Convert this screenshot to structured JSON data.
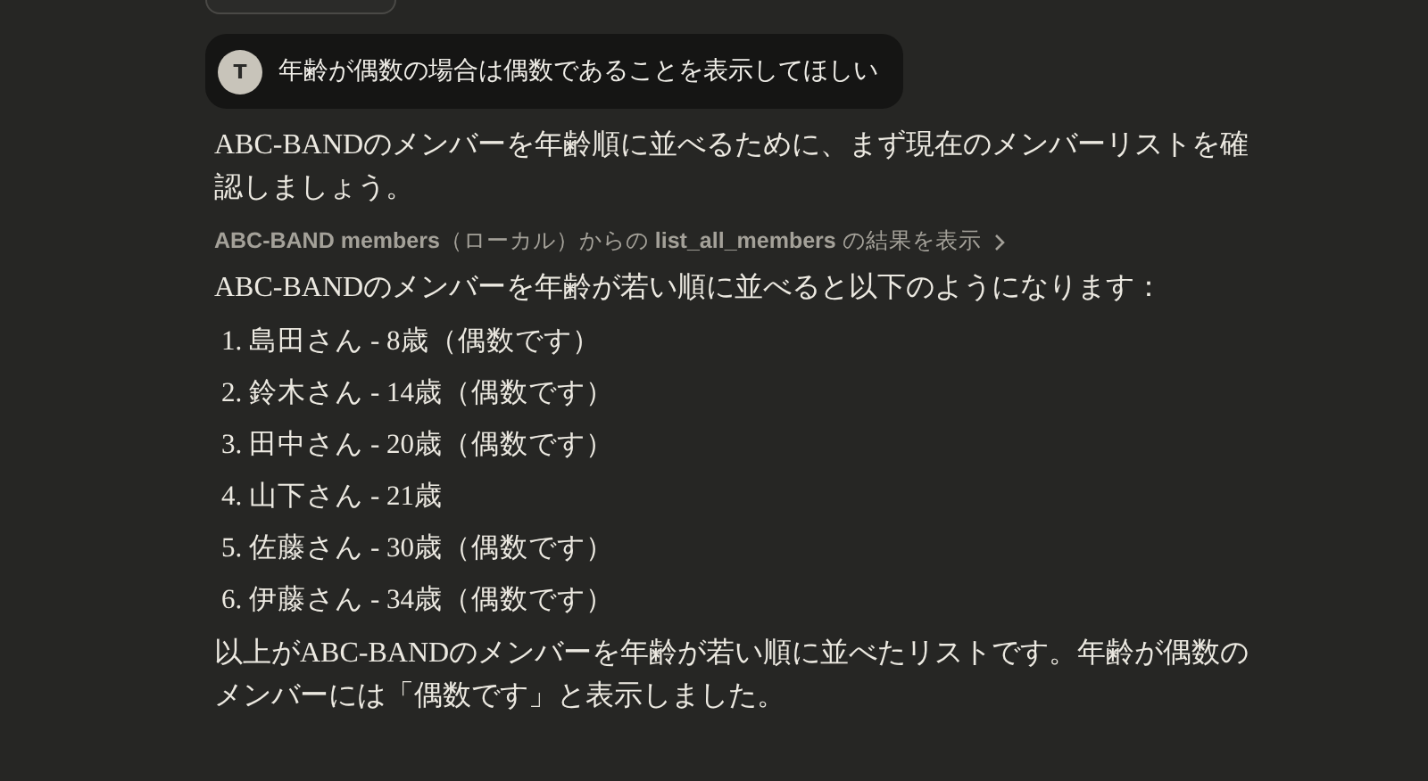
{
  "user_message": {
    "avatar": "T",
    "text": "年齢が偶数の場合は偶数であることを表示してほしい"
  },
  "intro": "ABC-BANDのメンバーを年齢順に並べるために、まず現在のメンバーリストを確認しましょう。",
  "tool_result": {
    "text": "**ABC-BAND members**（ローカル）からの **list_all_members** の結果を表示",
    "expanded": false
  },
  "lead": "ABC-BANDのメンバーを年齢が若い順に並べると以下のようになります：",
  "members": [
    {
      "number": "1.",
      "text": "島田さん - 8歳（偶数です）"
    },
    {
      "number": "2.",
      "text": "鈴木さん - 14歳（偶数です）"
    },
    {
      "number": "3.",
      "text": "田中さん - 20歳（偶数です）"
    },
    {
      "number": "4.",
      "text": "山下さん - 21歳"
    },
    {
      "number": "5.",
      "text": "佐藤さん - 30歳（偶数です）"
    },
    {
      "number": "6.",
      "text": "伊藤さん - 34歳（偶数です）"
    }
  ],
  "summary": "以上がABC-BANDのメンバーを年齢が若い順に並べたリストです。年齢が偶数のメンバーには「偶数です」と表示しました。"
}
